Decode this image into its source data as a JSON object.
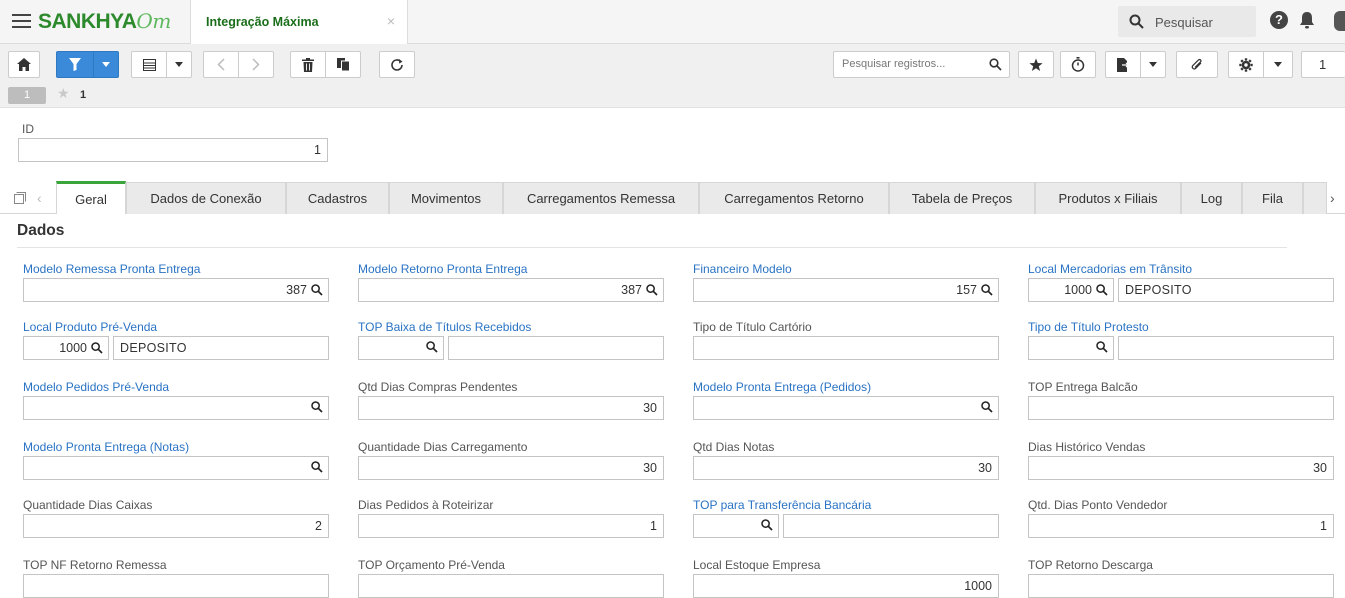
{
  "app": {
    "logo_text": "SANKHYA",
    "logo_suffix": "Om",
    "tab_title": "Integração Máxima",
    "tab_close": "×"
  },
  "topbar": {
    "search_label": "Pesquisar",
    "help": "?"
  },
  "toolbar": {
    "search_placeholder": "Pesquisar registros...",
    "page_value": "1"
  },
  "record": {
    "badge": "1",
    "fav_count": "1"
  },
  "id_field": {
    "label": "ID",
    "value": "1"
  },
  "tabs": [
    "Geral",
    "Dados de Conexão",
    "Cadastros",
    "Movimentos",
    "Carregamentos Remessa",
    "Carregamentos Retorno",
    "Tabela de Preços",
    "Produtos x Filiais",
    "Log",
    "Fila"
  ],
  "section": {
    "title": "Dados"
  },
  "fields": [
    {
      "label": "Modelo Remessa Pronta Entrega",
      "value": "387",
      "kind": "lookup",
      "link": true
    },
    {
      "label": "Modelo Retorno Pronta Entrega",
      "value": "387",
      "kind": "lookup",
      "link": true
    },
    {
      "label": "Financeiro Modelo",
      "value": "157",
      "kind": "lookup",
      "link": true
    },
    {
      "label": "Local Mercadorias em Trânsito",
      "value": "1000",
      "desc": "DEPOSITO",
      "kind": "lookup-desc",
      "link": true
    },
    {
      "label": "Local Produto Pré-Venda",
      "value": "1000",
      "desc": "DEPOSITO",
      "kind": "lookup-desc",
      "link": true
    },
    {
      "label": "TOP Baixa de Títulos Recebidos",
      "value": "",
      "desc": "",
      "kind": "lookup-desc",
      "link": true
    },
    {
      "label": "Tipo de Título Cartório",
      "value": "",
      "kind": "text",
      "link": false
    },
    {
      "label": "Tipo de Título Protesto",
      "value": "",
      "desc": "",
      "kind": "lookup-desc",
      "link": true
    },
    {
      "label": "Modelo Pedidos Pré-Venda",
      "value": "",
      "kind": "lookup",
      "link": true
    },
    {
      "label": "Qtd Dias Compras Pendentes",
      "value": "30",
      "kind": "number",
      "link": false
    },
    {
      "label": "Modelo Pronta Entrega (Pedidos)",
      "value": "",
      "kind": "lookup",
      "link": true
    },
    {
      "label": "TOP Entrega Balcão",
      "value": "",
      "kind": "text",
      "link": false
    },
    {
      "label": "Modelo Pronta Entrega (Notas)",
      "value": "",
      "kind": "lookup",
      "link": true
    },
    {
      "label": "Quantidade Dias Carregamento",
      "value": "30",
      "kind": "number",
      "link": false
    },
    {
      "label": "Qtd Dias Notas",
      "value": "30",
      "kind": "number",
      "link": false
    },
    {
      "label": "Dias Histórico Vendas",
      "value": "30",
      "kind": "number",
      "link": false
    },
    {
      "label": "Quantidade Dias Caixas",
      "value": "2",
      "kind": "number",
      "link": false
    },
    {
      "label": "Dias Pedidos à Roteirizar",
      "value": "1",
      "kind": "number",
      "link": false
    },
    {
      "label": "TOP para Transferência Bancária",
      "value": "",
      "desc": "",
      "kind": "lookup-desc",
      "link": true
    },
    {
      "label": "Qtd. Dias Ponto Vendedor",
      "value": "1",
      "kind": "number",
      "link": false
    },
    {
      "label": "TOP NF Retorno Remessa",
      "value": "",
      "kind": "text",
      "link": false
    },
    {
      "label": "TOP Orçamento Pré-Venda",
      "value": "",
      "kind": "text",
      "link": false
    },
    {
      "label": "Local Estoque Empresa",
      "value": "1000",
      "kind": "number",
      "link": false
    },
    {
      "label": "TOP Retorno Descarga",
      "value": "",
      "kind": "text",
      "link": false
    }
  ],
  "colors": {
    "accent_blue": "#3b8ad9",
    "link_blue": "#2a73c4",
    "brand_green": "#2c8a2c",
    "tab_active": "#3aa53a"
  }
}
